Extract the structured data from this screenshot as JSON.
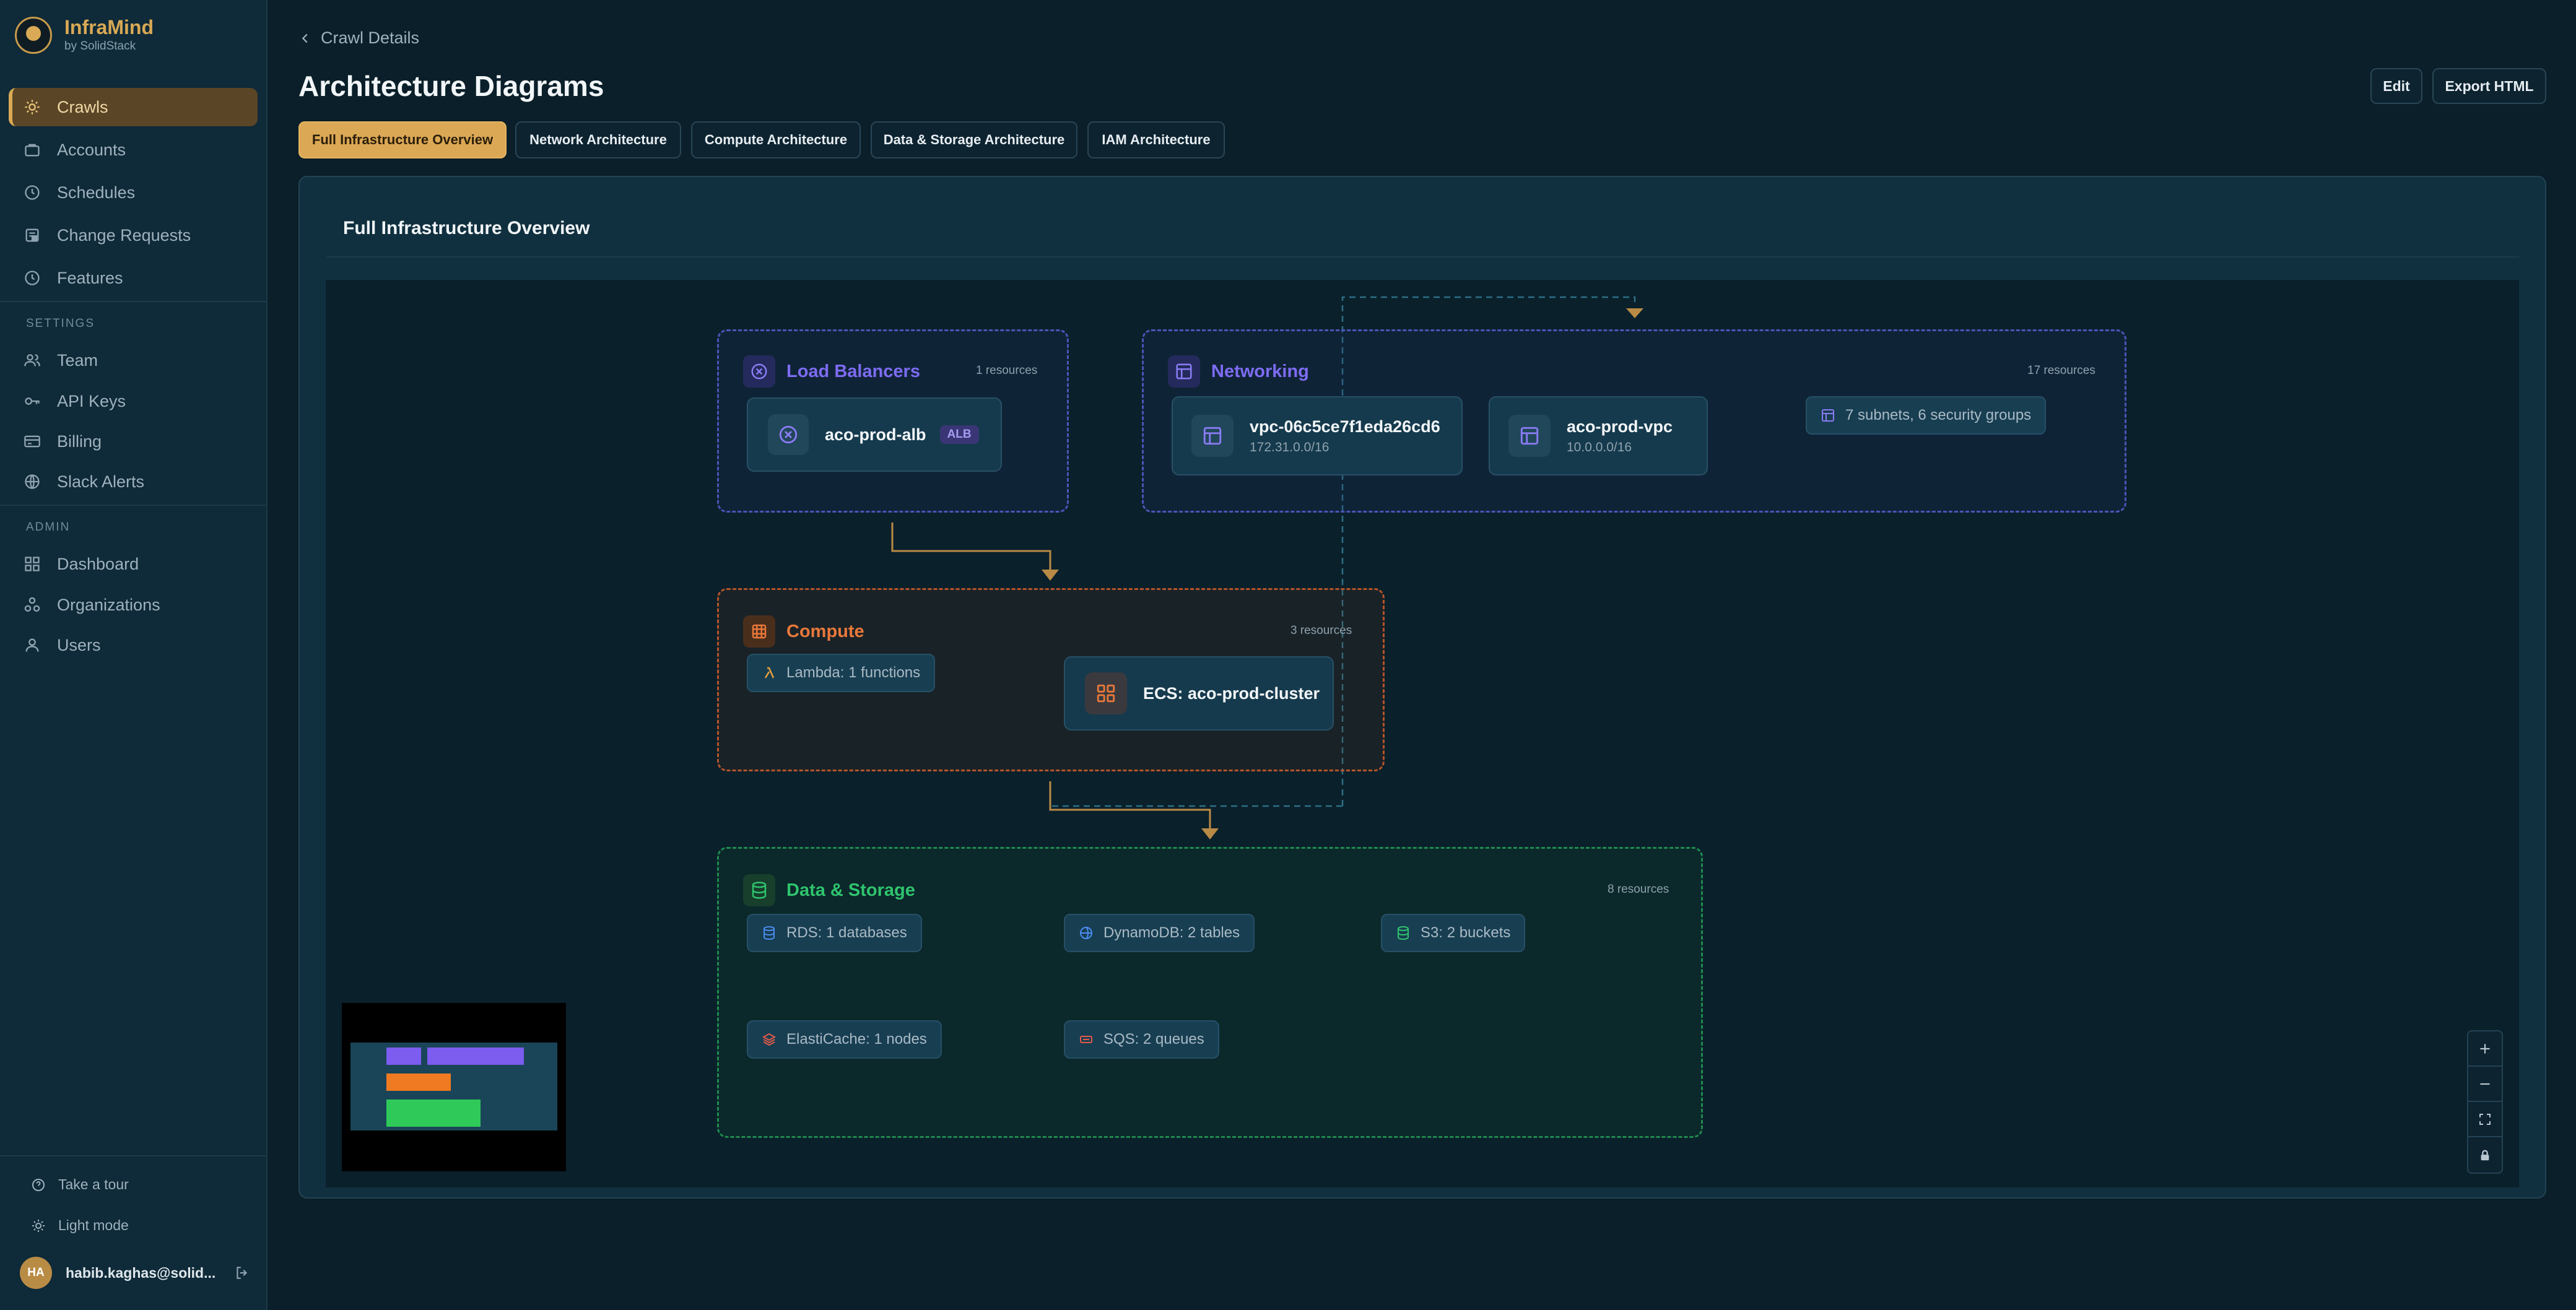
{
  "brand": {
    "name": "InfraMind",
    "sub": "by SolidStack"
  },
  "nav": {
    "main": [
      {
        "label": "Crawls",
        "icon": "sun-icon",
        "active": true
      },
      {
        "label": "Accounts",
        "icon": "briefcase-icon"
      },
      {
        "label": "Schedules",
        "icon": "clock-icon"
      },
      {
        "label": "Change Requests",
        "icon": "clipboard-icon"
      },
      {
        "label": "Features",
        "icon": "clock-icon"
      }
    ],
    "settings_label": "SETTINGS",
    "settings": [
      {
        "label": "Team",
        "icon": "users-icon"
      },
      {
        "label": "API Keys",
        "icon": "key-icon"
      },
      {
        "label": "Billing",
        "icon": "card-icon"
      },
      {
        "label": "Slack Alerts",
        "icon": "globe-icon"
      }
    ],
    "admin_label": "ADMIN",
    "admin": [
      {
        "label": "Dashboard",
        "icon": "grid-icon"
      },
      {
        "label": "Organizations",
        "icon": "org-icon"
      },
      {
        "label": "Users",
        "icon": "user-icon"
      }
    ]
  },
  "footer": {
    "tour": "Take a tour",
    "theme": "Light mode",
    "avatar_initials": "HA",
    "email": "habib.kaghas@solid..."
  },
  "header": {
    "back_label": "Crawl Details",
    "title": "Architecture Diagrams",
    "edit_label": "Edit",
    "export_label": "Export HTML"
  },
  "tabs": [
    {
      "label": "Full Infrastructure Overview",
      "active": true
    },
    {
      "label": "Network Architecture"
    },
    {
      "label": "Compute Architecture"
    },
    {
      "label": "Data & Storage Architecture"
    },
    {
      "label": "IAM Architecture"
    }
  ],
  "panel": {
    "title": "Full Infrastructure Overview"
  },
  "diagram": {
    "load_balancers": {
      "title": "Load Balancers",
      "count": "1 resources",
      "color": "#7d6cf2",
      "node": {
        "title": "aco-prod-alb",
        "badge": "ALB"
      }
    },
    "networking": {
      "title": "Networking",
      "count": "17 resources",
      "color": "#7d6cf2",
      "nodes": [
        {
          "title": "vpc-06c5ce7f1eda26cd6",
          "sub": "172.31.0.0/16"
        },
        {
          "title": "aco-prod-vpc",
          "sub": "10.0.0.0/16"
        }
      ],
      "chip": "7 subnets, 6 security groups"
    },
    "compute": {
      "title": "Compute",
      "count": "3 resources",
      "color": "#e9783a",
      "chip": "Lambda: 1 functions",
      "node": {
        "title": "ECS: aco-prod-cluster"
      }
    },
    "data_storage": {
      "title": "Data & Storage",
      "count": "8 resources",
      "color": "#2fc46d",
      "chips": [
        "RDS: 1 databases",
        "DynamoDB: 2 tables",
        "S3: 2 buckets",
        "ElastiCache: 1 nodes",
        "SQS: 2 queues"
      ]
    }
  },
  "colors": {
    "accent": "#dba855",
    "edge": "#b98a45"
  }
}
